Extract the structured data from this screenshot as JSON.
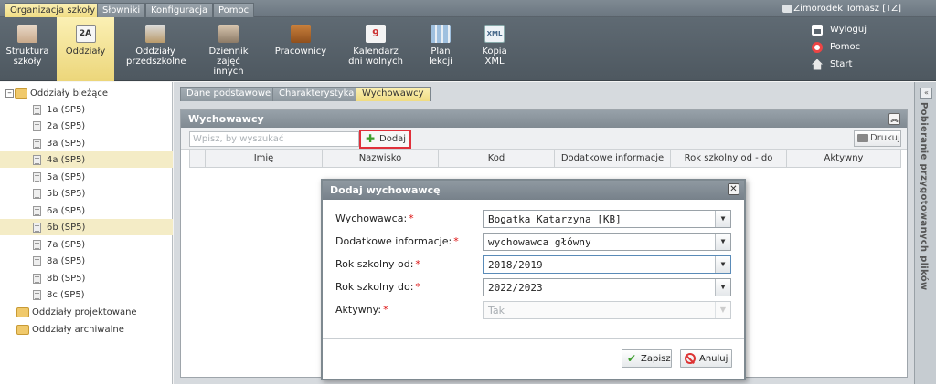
{
  "top_menu": [
    "Organizacja szkoły",
    "Słowniki",
    "Konfiguracja",
    "Pomoc"
  ],
  "user": "Zimorodek Tomasz [TZ]",
  "ribbon": [
    {
      "label": "Struktura szkoły",
      "icon": "school-structure-icon"
    },
    {
      "label": "Oddziały",
      "icon": "class-2a-icon"
    },
    {
      "label": "Oddziały przedszkolne",
      "icon": "preschool-group-icon"
    },
    {
      "label": "Dziennik zajęć innych",
      "icon": "journal-icon"
    },
    {
      "label": "Pracownicy",
      "icon": "briefcase-icon"
    },
    {
      "label": "Kalendarz dni wolnych",
      "icon": "calendar-icon"
    },
    {
      "label": "Plan lekcji",
      "icon": "timetable-icon"
    },
    {
      "label": "Kopia XML",
      "icon": "xml-file-icon"
    }
  ],
  "right_links": [
    "Wyloguj",
    "Pomoc",
    "Start"
  ],
  "tree": {
    "root": "Oddziały bieżące",
    "items": [
      "1a (SP5)",
      "2a (SP5)",
      "3a (SP5)",
      "4a (SP5)",
      "5a (SP5)",
      "5b (SP5)",
      "6a (SP5)",
      "6b (SP5)",
      "7a (SP5)",
      "8a (SP5)",
      "8b (SP5)",
      "8c (SP5)"
    ],
    "others": [
      "Oddziały projektowane",
      "Oddziały archiwalne"
    ]
  },
  "tabs": [
    "Dane podstawowe",
    "Charakterystyka",
    "Wychowawcy"
  ],
  "panel": {
    "title": "Wychowawcy",
    "search_placeholder": "Wpisz, by wyszukać",
    "add_label": "Dodaj",
    "print_label": "Drukuj",
    "columns": [
      "Imię",
      "Nazwisko",
      "Kod",
      "Dodatkowe informacje",
      "Rok szkolny od - do",
      "Aktywny"
    ]
  },
  "side_panel": "Pobieranie przygotowanych plików",
  "dialog": {
    "title": "Dodaj wychowawcę",
    "fields": [
      {
        "label": "Wychowawca:",
        "value": "Bogatka Katarzyna [KB]"
      },
      {
        "label": "Dodatkowe informacje:",
        "value": "wychowawca główny"
      },
      {
        "label": "Rok szkolny od:",
        "value": "2018/2019"
      },
      {
        "label": "Rok szkolny do:",
        "value": "2022/2023"
      },
      {
        "label": "Aktywny:",
        "value": "Tak"
      }
    ],
    "save_label": "Zapisz",
    "cancel_label": "Anuluj"
  }
}
